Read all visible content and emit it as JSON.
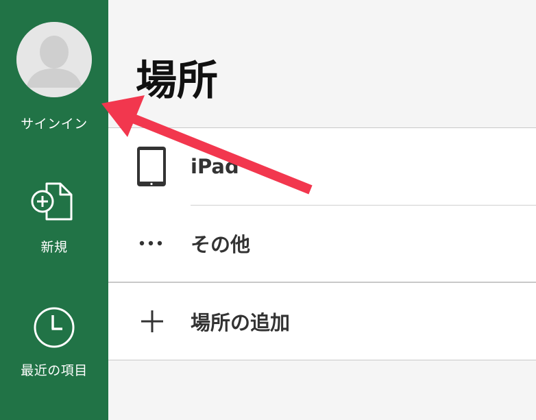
{
  "sidebar": {
    "background": "#217346",
    "sign_in_label": "サインイン",
    "new_label": "新規",
    "recent_label": "最近の項目"
  },
  "main": {
    "title": "場所",
    "locations": [
      {
        "label": "iPad",
        "icon": "ipad-icon"
      },
      {
        "label": "その他",
        "icon": "more-dots-icon"
      }
    ],
    "add_location_label": "場所の追加",
    "add_icon": "plus-icon"
  },
  "annotation": {
    "arrow_color": "#f2374e"
  }
}
